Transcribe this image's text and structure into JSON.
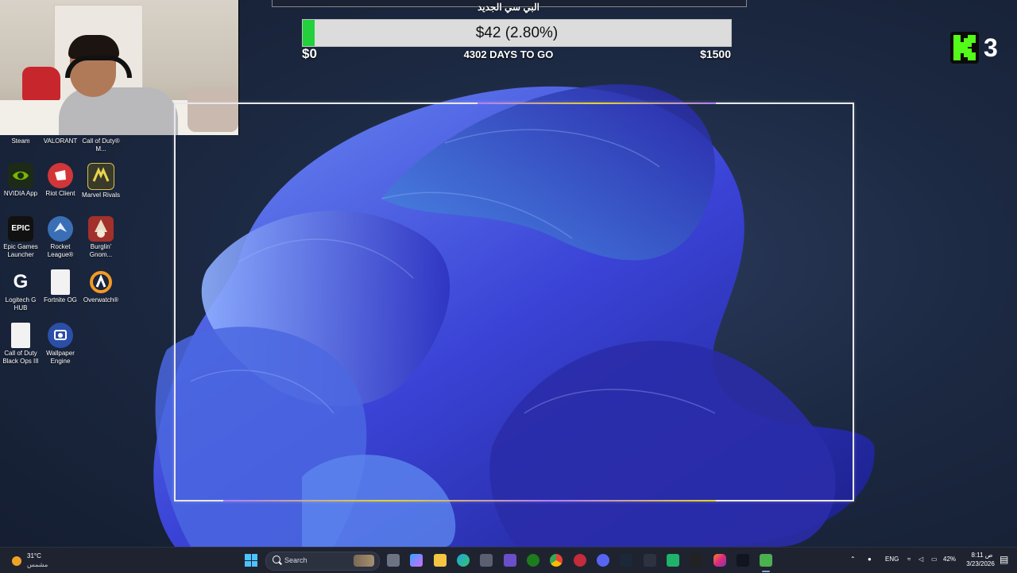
{
  "goal": {
    "title": "البي سي الجديد",
    "amount_label": "$42 (2.80%)",
    "progress_percent": 2.8,
    "start_label": "$0",
    "days_label": "4302 DAYS TO GO",
    "target_label": "$1500",
    "fill_color": "#22d13c"
  },
  "kick": {
    "count": "3",
    "color": "#53fc18"
  },
  "desktop_icons": [
    {
      "label": "Steam",
      "icon": "steam-icon",
      "label_only": true
    },
    {
      "label": "VALORANT",
      "icon": "valorant-icon",
      "label_only": true
    },
    {
      "label": "Call of Duty® M...",
      "icon": "call-of-duty-mobile-icon",
      "label_only": true
    },
    {
      "label": "NVIDIA App",
      "icon": "nvidia-icon"
    },
    {
      "label": "Riot Client",
      "icon": "riot-client-icon"
    },
    {
      "label": "Marvel Rivals",
      "icon": "marvel-rivals-icon"
    },
    {
      "label": "Epic Games Launcher",
      "icon": "epic-games-icon",
      "glyph": "EPIC"
    },
    {
      "label": "Rocket League®",
      "icon": "rocket-league-icon"
    },
    {
      "label": "Burglin' Gnom...",
      "icon": "burglin-gnomes-icon"
    },
    {
      "label": "Logitech G HUB",
      "icon": "logitech-g-hub-icon",
      "glyph": "G"
    },
    {
      "label": "Fortnite OG",
      "icon": "fortnite-og-file-icon"
    },
    {
      "label": "Overwatch®",
      "icon": "overwatch-icon"
    },
    {
      "label": "Call of Duty Black Ops III",
      "icon": "black-ops-3-file-icon"
    },
    {
      "label": "Wallpaper Engine",
      "icon": "wallpaper-engine-icon"
    }
  ],
  "taskbar": {
    "weather_temp": "31°C",
    "weather_desc": "مشمس",
    "search_label": "Search",
    "language": "ENG",
    "battery": "42%",
    "time": "ص 8:11",
    "date": "3/23/2026",
    "apps": [
      "file-explorer-icon",
      "copilot-icon",
      "folder-icon",
      "edge-icon",
      "store-icon",
      "app-icon",
      "xbox-icon",
      "chrome-icon",
      "app-red-icon",
      "discord-icon",
      "steam-icon",
      "app-arrow-icon",
      "spotify-like-icon",
      "epic-icon",
      "instagram-icon",
      "capcut-icon",
      "minecraft-icon"
    ]
  }
}
